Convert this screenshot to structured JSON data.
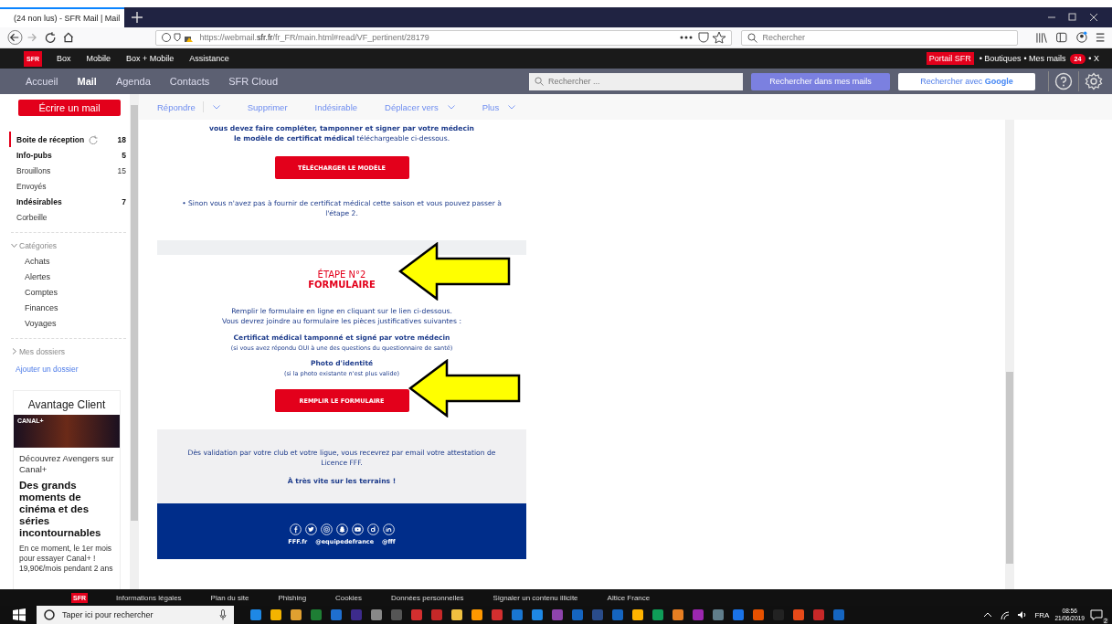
{
  "browser": {
    "tab": {
      "title": "(24 non lus) - SFR Mail | Mail",
      "selected": true
    },
    "url": {
      "prefix": "https://webmail.",
      "domain": "sfr.fr",
      "path": "/fr_FR/main.html#read/VF_pertinent/28179"
    },
    "search": {
      "placeholder": "Rechercher"
    }
  },
  "top_bar": {
    "logo": "SFR",
    "links": [
      "Box",
      "Mobile",
      "Box + Mobile",
      "Assistance"
    ],
    "portal": "Portail SFR",
    "right_links": [
      "• Boutiques",
      "• Mes mails"
    ],
    "mail_count": "24",
    "close": "• X"
  },
  "app_nav": {
    "items": [
      {
        "label": "Accueil",
        "selected": false
      },
      {
        "label": "Mail",
        "selected": true
      },
      {
        "label": "Agenda",
        "selected": false
      },
      {
        "label": "Contacts",
        "selected": false
      },
      {
        "label": "SFR Cloud",
        "selected": false
      }
    ],
    "search": {
      "placeholder": "Rechercher ..."
    },
    "search_mail_button": "Rechercher dans mes mails",
    "google_button": {
      "prefix": "Rechercher avec",
      "brand": "Google"
    }
  },
  "sidebar": {
    "compose_button": "Écrire un mail",
    "folders": [
      {
        "name": "Boite de réception",
        "count": "18",
        "unread": true,
        "selected": true,
        "refresh": true
      },
      {
        "name": "Info-pubs",
        "count": "5",
        "unread": true,
        "selected": false,
        "refresh": false
      },
      {
        "name": "Brouillons",
        "count": "15",
        "unread": false,
        "selected": false,
        "refresh": false
      },
      {
        "name": "Envoyés",
        "unread": false,
        "selected": false,
        "refresh": false
      },
      {
        "name": "Indésirables",
        "count": "7",
        "unread": true,
        "selected": false,
        "refresh": false
      },
      {
        "name": "Corbeille",
        "unread": false,
        "selected": false,
        "refresh": false
      }
    ],
    "groups": [
      {
        "label": "Catégories",
        "expanded": true,
        "children": [
          "Achats",
          "Alertes",
          "Comptes",
          "Finances",
          "Voyages"
        ]
      },
      {
        "label": "Mes dossiers",
        "expanded": false
      }
    ],
    "add_folder": "Ajouter un dossier",
    "ad": {
      "title": "Avantage Client",
      "image_caption": "CANAL+",
      "subtitle": "Découvrez Avengers sur Canal+",
      "headline": "Des grands moments de cinéma et des séries incontournables",
      "body": "En ce moment, le 1er mois pour essayer Canal+ ! 19,90€/mois pendant 2 ans"
    }
  },
  "toolbar": [
    {
      "label": "Répondre",
      "dropdown": true,
      "split": true
    },
    {
      "label": "Supprimer",
      "dropdown": false,
      "split": false
    },
    {
      "label": "Indésirable",
      "dropdown": false,
      "split": false
    },
    {
      "label": "Déplacer vers",
      "dropdown": true,
      "split": false
    },
    {
      "label": "Plus",
      "dropdown": true,
      "split": false
    }
  ],
  "email": {
    "intro_lines": [
      "vous devez faire compléter, tamponner et signer par votre médecin",
      "**le modèle de certificat médical** téléchargeable ci-dessous."
    ],
    "download_button": "TÉLÉCHARGER LE MODÈLE",
    "bullet": "• Sinon vous n'avez pas à fournir de certificat médical cette saison et vous pouvez passer à l'étape 2.",
    "step_label": "ÉTAPE N°2",
    "step_title": "FORMULAIRE",
    "step_text": [
      "Remplir le formulaire en ligne en cliquant sur le lien ci-dessous.",
      "Vous devrez joindre au formulaire les pièces justificatives suivantes :"
    ],
    "documents": [
      {
        "title": "Certificat médical tamponné et signé par votre médecin",
        "note": "(si vous avez répondu OUI à une des questions du questionnaire de santé)"
      },
      {
        "title": "Photo d'identité",
        "note": "(si la photo existante n'est plus valide)"
      }
    ],
    "form_button": "REMPLIR LE FORMULAIRE",
    "validation": "Dès validation par votre club et votre ligue, vous recevrez par email votre attestation de Licence FFF.",
    "farewell": "À très vite sur les terrains !",
    "social": [
      {
        "kind": "facebook"
      },
      {
        "kind": "twitter"
      },
      {
        "kind": "instagram"
      },
      {
        "kind": "snapchat"
      },
      {
        "kind": "youtube"
      },
      {
        "kind": "dailymotion"
      },
      {
        "kind": "linkedin"
      }
    ],
    "footer_labels": [
      "FFF.fr",
      "@equipedefrance",
      "@fff"
    ]
  },
  "site_footer": {
    "logo": "SFR",
    "links": [
      "Informations légales",
      "Plan du site",
      "Phishing",
      "Cookies",
      "Données personnelles",
      "Signaler un contenu illicite",
      "Altice France"
    ]
  },
  "taskbar": {
    "search_placeholder": "Taper ici pour rechercher",
    "language": "FRA",
    "time": "08:56",
    "date": "21/06/2019",
    "notifications": "2"
  }
}
